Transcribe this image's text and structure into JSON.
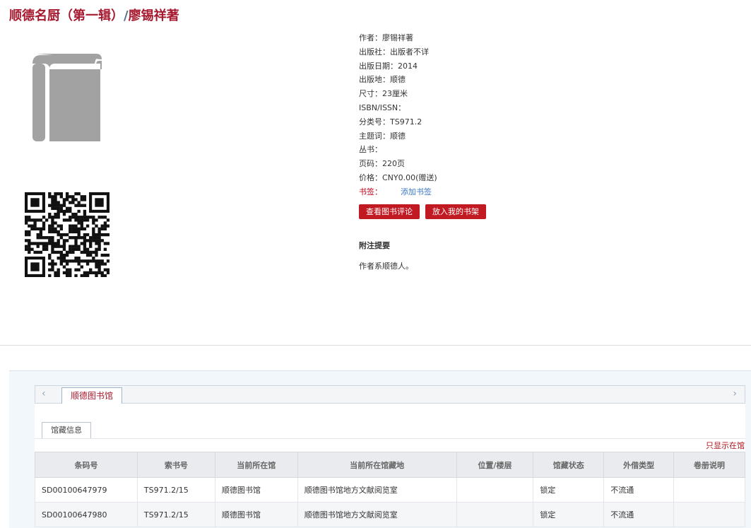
{
  "title": {
    "book": "顺德名厨（第一辑）",
    "separator": "/",
    "author": "廖锡祥著"
  },
  "book_icon": "book-icon",
  "qr_icon": "qr-code-icon",
  "details": [
    {
      "label": "作者：",
      "value": "廖锡祥著"
    },
    {
      "label": "出版社：",
      "value": "出版者不详"
    },
    {
      "label": "出版日期：",
      "value": "2014"
    },
    {
      "label": "出版地：",
      "value": "顺德"
    },
    {
      "label": "尺寸：",
      "value": "23厘米"
    },
    {
      "label": "ISBN/ISSN：",
      "value": ""
    },
    {
      "label": "分类号：",
      "value": "TS971.2"
    },
    {
      "label": "主题词：",
      "value": "顺德"
    },
    {
      "label": "丛书：",
      "value": ""
    },
    {
      "label": "页码：",
      "value": "220页"
    },
    {
      "label": "价格：",
      "value": "CNY0.00(赠送)"
    }
  ],
  "tags": {
    "label": "书签：",
    "add_link": "添加书签"
  },
  "buttons": {
    "reviews": "查看图书评论",
    "shelf": "放入我的书架"
  },
  "notes": {
    "heading": "附注提要",
    "body": "作者系顺德人。"
  },
  "library": {
    "tab": "顺德图书馆",
    "left_arrow": "‹",
    "right_arrow": "›"
  },
  "holdings": {
    "subtab": "馆藏信息",
    "only_available": "只显示在馆",
    "columns": [
      "条码号",
      "索书号",
      "当前所在馆",
      "当前所在馆藏地",
      "位置/楼层",
      "馆藏状态",
      "外借类型",
      "卷册说明"
    ],
    "rows": [
      [
        "SD00100647979",
        "TS971.2/15",
        "顺德图书馆",
        "顺德图书馆地方文献阅览室",
        "",
        "锁定",
        "不流通",
        ""
      ],
      [
        "SD00100647980",
        "TS971.2/15",
        "顺德图书馆",
        "顺德图书馆地方文献阅览室",
        "",
        "锁定",
        "不流通",
        ""
      ]
    ]
  },
  "colors": {
    "accent": "#a6192e",
    "button": "#c21a22",
    "link": "#3a77c6"
  }
}
